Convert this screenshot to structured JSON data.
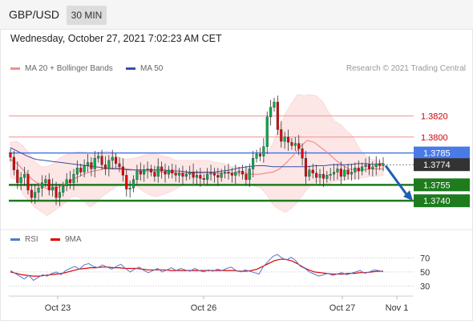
{
  "header": {
    "symbol": "GBP/USD",
    "timeframe": "30 MIN"
  },
  "datetime": "Wednesday, October 27, 2021 7:02:23 AM CET",
  "legend": {
    "bollinger": "MA 20 + Bollinger Bands",
    "ma50": "MA 50",
    "copyright": "Research © 2021 Trading Central",
    "rsi": "RSI",
    "rsi_ma": "9MA"
  },
  "colors": {
    "bull": "#00b050",
    "bear": "#e60000",
    "support": "#1e7b1e",
    "pivot": "#4a7ae6",
    "resistance": "#f29090",
    "ma50": "#3a4fa8",
    "bollinger_fill": "#fde6e6",
    "arrow": "#1f5fb0",
    "rsi": "#5577cc",
    "rsi_ma": "#dd0000"
  },
  "chart_data": [
    {
      "type": "candlestick",
      "ylim": [
        1.3722,
        1.3855
      ],
      "x_ticks": [
        "Oct 23",
        "Oct 26",
        "Oct 27",
        "Nov 1"
      ],
      "levels": [
        {
          "value": 1.382,
          "label": "1.3820",
          "kind": "resistance"
        },
        {
          "value": 1.38,
          "label": "1.3800",
          "kind": "resistance"
        },
        {
          "value": 1.3785,
          "label": "1.3785",
          "kind": "pivot"
        },
        {
          "value": 1.3774,
          "label": "1.3774",
          "kind": "last"
        },
        {
          "value": 1.3755,
          "label": "1.3755",
          "kind": "support"
        },
        {
          "value": 1.374,
          "label": "1.3740",
          "kind": "support"
        }
      ],
      "projection": {
        "from": 1.3773,
        "to": 1.374
      },
      "closes": [
        1.3781,
        1.3769,
        1.3757,
        1.3762,
        1.3765,
        1.375,
        1.3743,
        1.3748,
        1.3752,
        1.3757,
        1.376,
        1.375,
        1.3753,
        1.3743,
        1.3748,
        1.3754,
        1.376,
        1.3757,
        1.3765,
        1.3771,
        1.3767,
        1.3773,
        1.3776,
        1.377,
        1.378,
        1.3782,
        1.3774,
        1.377,
        1.3778,
        1.3781,
        1.3775,
        1.3772,
        1.3764,
        1.3751,
        1.3752,
        1.376,
        1.3768,
        1.3765,
        1.3769,
        1.377,
        1.3767,
        1.3763,
        1.3772,
        1.3768,
        1.3765,
        1.3769,
        1.3766,
        1.3764,
        1.3766,
        1.3763,
        1.3765,
        1.3767,
        1.3762,
        1.3764,
        1.3761,
        1.376,
        1.3765,
        1.3766,
        1.3764,
        1.3762,
        1.3766,
        1.3767,
        1.3766,
        1.3764,
        1.3767,
        1.3768,
        1.3765,
        1.376,
        1.377,
        1.378,
        1.3784,
        1.3782,
        1.3791,
        1.3819,
        1.3828,
        1.3833,
        1.3807,
        1.3796,
        1.38,
        1.3795,
        1.3792,
        1.3794,
        1.3789,
        1.378,
        1.3763,
        1.3769,
        1.3766,
        1.3762,
        1.3765,
        1.3761,
        1.3764,
        1.3765,
        1.3767,
        1.377,
        1.3763,
        1.3769,
        1.3765,
        1.3767,
        1.3771,
        1.3768,
        1.3772,
        1.3774,
        1.377,
        1.3772,
        1.3775,
        1.3773,
        1.3775
      ],
      "bollinger_upper": [
        1.3795,
        1.3796,
        1.3792,
        1.3785,
        1.3777,
        1.3772,
        1.3772,
        1.3775,
        1.378,
        1.3783,
        1.3785,
        1.3786,
        1.3786,
        1.3785,
        1.3785,
        1.3786,
        1.3787,
        1.3784,
        1.378,
        1.3779,
        1.378,
        1.3781,
        1.3783,
        1.3784,
        1.3784,
        1.3782,
        1.3781,
        1.3778,
        1.3778,
        1.3778,
        1.3778,
        1.3778,
        1.3778,
        1.3777,
        1.3776,
        1.3775,
        1.3772,
        1.3772,
        1.377,
        1.3771,
        1.3773,
        1.3775,
        1.3784,
        1.3795,
        1.381,
        1.3822,
        1.3832,
        1.384,
        1.3839,
        1.384,
        1.3839,
        1.3834,
        1.3824,
        1.3815,
        1.3812,
        1.3806,
        1.3801,
        1.379,
        1.3783,
        1.3779,
        1.3778,
        1.3775
      ],
      "bollinger_lower": [
        1.3762,
        1.376,
        1.3746,
        1.374,
        1.3734,
        1.373,
        1.3726,
        1.373,
        1.3734,
        1.3738,
        1.3744,
        1.3744,
        1.374,
        1.3734,
        1.3738,
        1.3744,
        1.3748,
        1.3752,
        1.3756,
        1.3757,
        1.3756,
        1.3752,
        1.3748,
        1.3745,
        1.3744,
        1.3746,
        1.3748,
        1.3751,
        1.3754,
        1.3755,
        1.3755,
        1.3755,
        1.3754,
        1.3754,
        1.3754,
        1.3755,
        1.3755,
        1.3756,
        1.3757,
        1.3755,
        1.3754,
        1.3752,
        1.3745,
        1.3736,
        1.3732,
        1.3729,
        1.3733,
        1.3739,
        1.3747,
        1.3754,
        1.3758,
        1.3757,
        1.3756,
        1.3758,
        1.3759,
        1.376,
        1.3761,
        1.3761,
        1.3762,
        1.3763,
        1.3763,
        1.3764
      ],
      "ma50": [
        1.379,
        1.3786,
        1.3782,
        1.3779,
        1.3778,
        1.3777,
        1.3776,
        1.3775,
        1.3774,
        1.3773,
        1.3772,
        1.3771,
        1.377,
        1.377,
        1.3769,
        1.3769,
        1.3769,
        1.3769,
        1.3769,
        1.3768,
        1.3768,
        1.3767,
        1.3767,
        1.3767,
        1.3767,
        1.3768,
        1.3769,
        1.3771,
        1.3772,
        1.3773,
        1.3773,
        1.3772,
        1.3772,
        1.3772,
        1.3772,
        1.3772,
        1.3773,
        1.3773,
        1.3774,
        1.3774,
        1.3774,
        1.3775,
        1.3775,
        1.3774,
        1.3775
      ],
      "ma20": [
        1.3779,
        1.3775,
        1.3768,
        1.3761,
        1.3756,
        1.3752,
        1.3751,
        1.3753,
        1.3756,
        1.376,
        1.3763,
        1.3766,
        1.3768,
        1.3769,
        1.3771,
        1.3771,
        1.3771,
        1.377,
        1.3769,
        1.3768,
        1.3768,
        1.3768,
        1.3767,
        1.3767,
        1.3766,
        1.3766,
        1.3766,
        1.3766,
        1.3766,
        1.3766,
        1.3766,
        1.3766,
        1.3766,
        1.3766,
        1.3766,
        1.3765,
        1.3765,
        1.3766,
        1.3767,
        1.377,
        1.3776,
        1.3783,
        1.3791,
        1.3797,
        1.3795,
        1.379,
        1.3785,
        1.3779,
        1.3774,
        1.377,
        1.3769,
        1.3769,
        1.377,
        1.377,
        1.377
      ]
    },
    {
      "type": "line",
      "title": "RSI",
      "ylim": [
        20,
        82
      ],
      "y_ticks": [
        70,
        50,
        30
      ],
      "series": [
        {
          "name": "RSI",
          "values": [
            52,
            48,
            44,
            40,
            45,
            38,
            42,
            46,
            44,
            48,
            50,
            46,
            52,
            55,
            58,
            54,
            60,
            62,
            58,
            56,
            60,
            57,
            54,
            58,
            61,
            55,
            50,
            54,
            57,
            52,
            49,
            52,
            55,
            50,
            53,
            56,
            52,
            55,
            53,
            51,
            55,
            52,
            50,
            53,
            51,
            54,
            52,
            55,
            57,
            52,
            50,
            53,
            51,
            49,
            47,
            58,
            65,
            72,
            75,
            70,
            67,
            71,
            66,
            58,
            55,
            50,
            47,
            44,
            46,
            48,
            45,
            47,
            49,
            46,
            48,
            50,
            52,
            48,
            50,
            53,
            52,
            50
          ]
        },
        {
          "name": "9MA",
          "values": [
            50,
            48,
            46,
            45,
            44,
            44,
            45,
            46,
            47,
            48,
            50,
            52,
            54,
            55,
            56,
            56,
            57,
            57,
            56,
            56,
            55,
            55,
            55,
            54,
            53,
            53,
            53,
            53,
            52,
            52,
            52,
            52,
            52,
            52,
            52,
            52,
            52,
            52,
            52,
            52,
            51,
            51,
            52,
            54,
            58,
            62,
            66,
            68,
            68,
            66,
            62,
            57,
            53,
            50,
            49,
            48,
            47,
            47,
            47,
            48,
            48,
            49,
            49,
            50,
            51,
            51
          ]
        }
      ]
    }
  ]
}
